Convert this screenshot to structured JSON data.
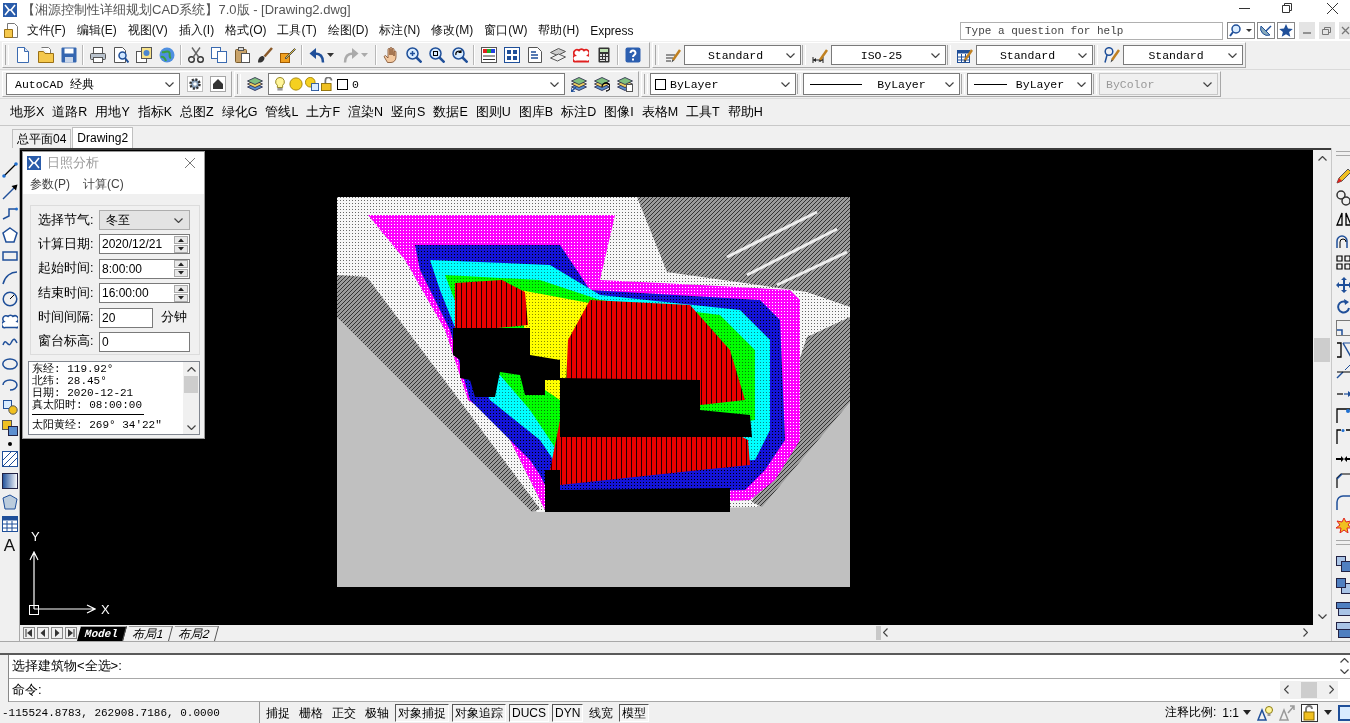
{
  "window": {
    "title": "【湘源控制性详细规划CAD系统】7.0版 - [Drawing2.dwg]"
  },
  "menu_bar": {
    "items": [
      "文件(F)",
      "编辑(E)",
      "视图(V)",
      "插入(I)",
      "格式(O)",
      "工具(T)",
      "绘图(D)",
      "标注(N)",
      "修改(M)",
      "窗口(W)",
      "帮助(H)",
      "Express"
    ],
    "help_search": {
      "placeholder": "Type a question for help"
    }
  },
  "styles_toolbar": {
    "text_style": "Standard",
    "dimension_style": "ISO-25",
    "table_style": "Standard",
    "multileader_style": "Standard"
  },
  "workspace_toolbar": {
    "workspace": "AutoCAD 经典"
  },
  "layers_toolbar": {
    "layer": "0"
  },
  "properties_toolbar": {
    "color_control": "ByLayer",
    "linetype": "ByLayer",
    "lineweight": "ByLayer",
    "plot_style": {
      "value": "ByColor",
      "disabled": true
    }
  },
  "app_menu": {
    "items": [
      "地形X",
      "道路R",
      "用地Y",
      "指标K",
      "总图Z",
      "绿化G",
      "管线L",
      "土方F",
      "渲染N",
      "竖向S",
      "数据E",
      "图则U",
      "图库B",
      "标注D",
      "图像I",
      "表格M",
      "工具T",
      "帮助H"
    ]
  },
  "document_tabs": [
    {
      "label": "总平面04",
      "selected": false
    },
    {
      "label": "Drawing2",
      "selected": true
    }
  ],
  "draw_toolbar": {
    "text_glyph": "A"
  },
  "dialog": {
    "title": "日照分析",
    "menus": [
      "参数(P)",
      "计算(C)"
    ],
    "fields": [
      {
        "kind": "select",
        "label": "选择节气:",
        "value": "冬至"
      },
      {
        "kind": "spinner",
        "label": "计算日期:",
        "value": "2020/12/21"
      },
      {
        "kind": "spinner",
        "label": "起始时间:",
        "value": "8:00:00"
      },
      {
        "kind": "spinner",
        "label": "结束时间:",
        "value": "16:00:00"
      },
      {
        "kind": "text",
        "label": "时间间隔:",
        "value": "20",
        "unit": "分钟"
      },
      {
        "kind": "text",
        "label": "窗台标高:",
        "value": "0"
      }
    ],
    "results": [
      {
        "kind": "line",
        "text": "东经: 119.92°"
      },
      {
        "kind": "line",
        "text": "北纬: 28.45°"
      },
      {
        "kind": "line",
        "text": "日期: 2020-12-21"
      },
      {
        "kind": "line",
        "text": "真太阳时: 08:00:00"
      },
      {
        "kind": "rule"
      },
      {
        "kind": "line",
        "text": "太阳黄经: 269° 34′22″"
      }
    ]
  },
  "canvas": {
    "ucs": {
      "y_label": "Y",
      "x_label": "X"
    }
  },
  "layout_tabs": [
    {
      "label": "Model",
      "selected": true
    },
    {
      "label": "布局1",
      "selected": false
    },
    {
      "label": "布局2",
      "selected": false
    }
  ],
  "command_line": {
    "history": [
      "选择建筑物<全选>:"
    ],
    "prompt": "命令:"
  },
  "status_bar": {
    "coordinates": "-115524.8783, 262908.7186, 0.0000",
    "toggles": [
      {
        "label": "捕捉",
        "on": false
      },
      {
        "label": "栅格",
        "on": false
      },
      {
        "label": "正交",
        "on": false
      },
      {
        "label": "极轴",
        "on": false
      },
      {
        "label": "对象捕捉",
        "on": true
      },
      {
        "label": "对象追踪",
        "on": true
      },
      {
        "label": "DUCS",
        "on": true
      },
      {
        "label": "DYN",
        "on": true
      },
      {
        "label": "线宽",
        "on": false
      },
      {
        "label": "模型",
        "on": true
      }
    ],
    "annotation_scale": {
      "label": "注释比例:",
      "value": "1:1"
    }
  }
}
